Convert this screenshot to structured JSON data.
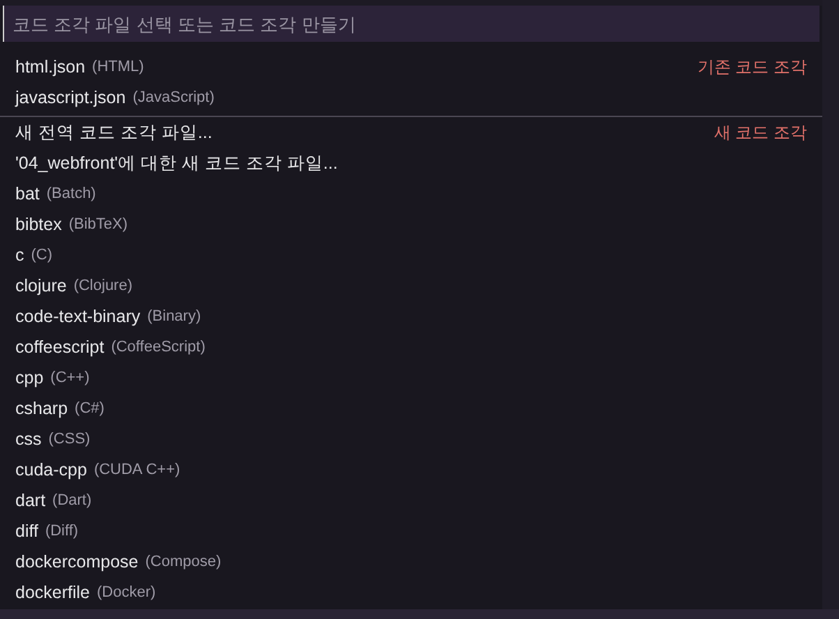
{
  "search": {
    "placeholder": "코드 조각 파일 선택 또는 코드 조각 만들기"
  },
  "groups": [
    {
      "label": "기존 코드 조각",
      "items": [
        {
          "name": "html.json",
          "description": "(HTML)"
        },
        {
          "name": "javascript.json",
          "description": "(JavaScript)"
        }
      ]
    },
    {
      "label": "새 코드 조각",
      "items": [
        {
          "name": "새 전역 코드 조각 파일..."
        },
        {
          "name": "'04_webfront'에 대한 새 코드 조각 파일..."
        },
        {
          "name": "bat",
          "description": "(Batch)"
        },
        {
          "name": "bibtex",
          "description": "(BibTeX)"
        },
        {
          "name": "c",
          "description": "(C)"
        },
        {
          "name": "clojure",
          "description": "(Clojure)"
        },
        {
          "name": "code-text-binary",
          "description": "(Binary)"
        },
        {
          "name": "coffeescript",
          "description": "(CoffeeScript)"
        },
        {
          "name": "cpp",
          "description": "(C++)"
        },
        {
          "name": "csharp",
          "description": "(C#)"
        },
        {
          "name": "css",
          "description": "(CSS)"
        },
        {
          "name": "cuda-cpp",
          "description": "(CUDA C++)"
        },
        {
          "name": "dart",
          "description": "(Dart)"
        },
        {
          "name": "diff",
          "description": "(Diff)"
        },
        {
          "name": "dockercompose",
          "description": "(Compose)"
        },
        {
          "name": "dockerfile",
          "description": "(Docker)"
        }
      ]
    }
  ]
}
